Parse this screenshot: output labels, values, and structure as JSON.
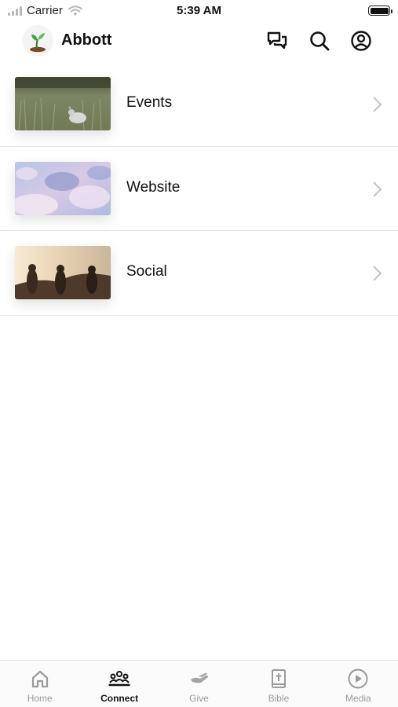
{
  "status_bar": {
    "carrier": "Carrier",
    "time": "5:39 AM"
  },
  "header": {
    "title": "Abbott",
    "logo_icon": "sprout-logo",
    "actions": [
      "messages-icon",
      "search-icon",
      "profile-icon"
    ]
  },
  "list": {
    "items": [
      {
        "label": "Events",
        "image": "field-with-dog-photo"
      },
      {
        "label": "Website",
        "image": "pastel-clouds-photo"
      },
      {
        "label": "Social",
        "image": "friends-at-sunset-photo"
      }
    ]
  },
  "tab_bar": {
    "active": "Connect",
    "tabs": [
      {
        "label": "Home",
        "icon": "home-icon"
      },
      {
        "label": "Connect",
        "icon": "people-icon"
      },
      {
        "label": "Give",
        "icon": "give-hand-icon"
      },
      {
        "label": "Bible",
        "icon": "bible-icon"
      },
      {
        "label": "Media",
        "icon": "play-circle-icon"
      }
    ]
  },
  "colors": {
    "active_tab": "#111111",
    "inactive_tab": "#9a9a9a",
    "divider": "#e6e6e6",
    "logo_leaf": "#3f9a3a"
  }
}
